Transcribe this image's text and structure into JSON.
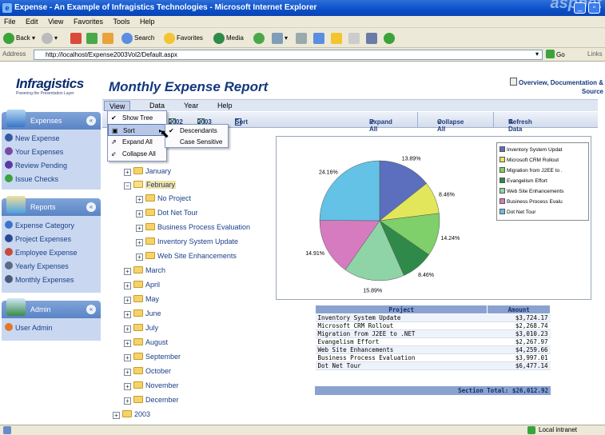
{
  "window": {
    "title": "Expense - An Example of Infragistics Technologies - Microsoft Internet Explorer",
    "watermark": "aspnet",
    "controls": [
      "_",
      "▫"
    ]
  },
  "ie_menu": [
    "File",
    "Edit",
    "View",
    "Favorites",
    "Tools",
    "Help"
  ],
  "ie_toolbar": {
    "back": "Back",
    "search": "Search",
    "favorites": "Favorites",
    "media": "Media"
  },
  "address": {
    "label": "Address",
    "url": "http://localhost/Expense2003Vol2/Default.aspx",
    "go": "Go",
    "links": "Links"
  },
  "brand": {
    "name": "Infragistics",
    "tagline": "Powering the Presentation Layer"
  },
  "page_title": "Monthly Expense Report",
  "overview_link": "Overview, Documentation & Source",
  "app_menu": [
    "View",
    "Data",
    "Year",
    "Help"
  ],
  "strip": {
    "year2002": "2002",
    "year2003": "2003",
    "sort": "Sort",
    "expand_all": "Expand All",
    "collapse_all": "Collapse All",
    "refresh": "Refresh Data"
  },
  "view_menu": {
    "items": [
      "Show Tree",
      "Sort",
      "Expand All",
      "Collapse All"
    ],
    "sort_submenu": [
      "Descendants",
      "Case Sensitive"
    ]
  },
  "sidebar": {
    "expenses": {
      "title": "Expenses",
      "items": [
        "New Expense",
        "Your Expenses",
        "Review Pending",
        "Issue Checks"
      ]
    },
    "reports": {
      "title": "Reports",
      "items": [
        "Expense Category",
        "Project Expenses",
        "Employee Expense",
        "Yearly Expenses",
        "Monthly Expenses"
      ]
    },
    "admin": {
      "title": "Admin",
      "items": [
        "User Admin"
      ]
    }
  },
  "tree": {
    "months_before": [
      "January"
    ],
    "expanded_month": "February",
    "february_children": [
      "No Project",
      "Dot Net Tour",
      "Business Process Evaluation",
      "Inventory System Update",
      "Web Site Enhancements"
    ],
    "months_after": [
      "March",
      "April",
      "May",
      "June",
      "July",
      "August",
      "September",
      "October",
      "November",
      "December"
    ],
    "next_year": "2003"
  },
  "chart_data": {
    "type": "pie",
    "title": "",
    "labels": [
      "Inventory System Update",
      "Microsoft CRM Rollout",
      "Migration from J2EE to .NET",
      "Evangelism Effort",
      "Web Site Enhancements",
      "Business Process Evaluation",
      "Dot Net Tour"
    ],
    "values": [
      3724.17,
      2268.74,
      3010.23,
      2267.97,
      4259.66,
      3997.01,
      6477.14
    ],
    "slice_labels": [
      "13.89%",
      "8.46%",
      "14.24%",
      "8.46%",
      "15.89%",
      "14.91%",
      "24.16%"
    ],
    "colors": [
      "#5b6fbe",
      "#e2e65a",
      "#7fcf6a",
      "#2f8a4a",
      "#8fd4a6",
      "#d77bc0",
      "#63c2e6"
    ],
    "legend": [
      "Inventory System Updat",
      "Microsoft CRM Rollout",
      "Migration from J2EE to .",
      "Evangelism Effort",
      "Web Site Enhancements",
      "Business Process Evalu",
      "Dot Net Tour"
    ],
    "legend_position": "right"
  },
  "table": {
    "headers": [
      "Project",
      "Amount"
    ],
    "rows": [
      [
        "Inventory System Update",
        "$3,724.17"
      ],
      [
        "Microsoft CRM Rollout",
        "$2,268.74"
      ],
      [
        "Migration from J2EE to .NET",
        "$3,010.23"
      ],
      [
        "Evangelism Effort",
        "$2,267.97"
      ],
      [
        "Web Site Enhancements",
        "$4,259.66"
      ],
      [
        "Business Process Evaluation",
        "$3,997.01"
      ],
      [
        "Dot Net Tour",
        "$6,477.14"
      ]
    ],
    "total": "Section Total: $26,012.92"
  },
  "status": {
    "zone": "Local intranet"
  }
}
